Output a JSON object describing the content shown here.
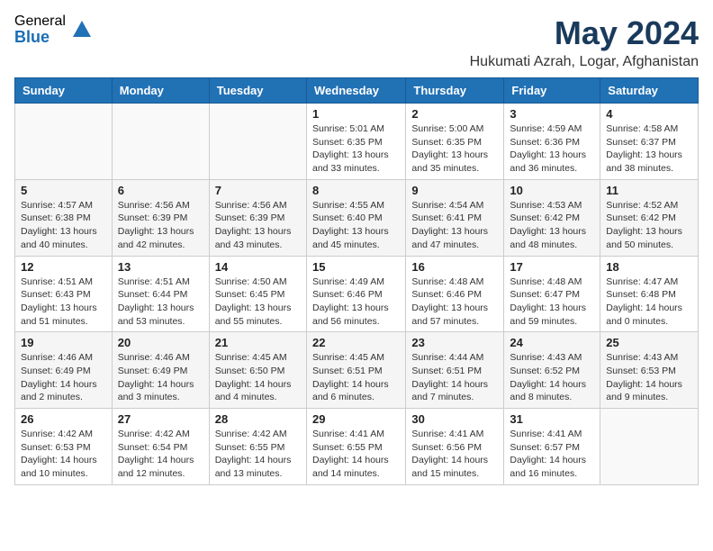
{
  "logo": {
    "general": "General",
    "blue": "Blue"
  },
  "title": {
    "month": "May 2024",
    "location": "Hukumati Azrah, Logar, Afghanistan"
  },
  "weekdays": [
    "Sunday",
    "Monday",
    "Tuesday",
    "Wednesday",
    "Thursday",
    "Friday",
    "Saturday"
  ],
  "weeks": [
    [
      {
        "day": "",
        "sunrise": "",
        "sunset": "",
        "daylight": ""
      },
      {
        "day": "",
        "sunrise": "",
        "sunset": "",
        "daylight": ""
      },
      {
        "day": "",
        "sunrise": "",
        "sunset": "",
        "daylight": ""
      },
      {
        "day": "1",
        "sunrise": "Sunrise: 5:01 AM",
        "sunset": "Sunset: 6:35 PM",
        "daylight": "Daylight: 13 hours and 33 minutes."
      },
      {
        "day": "2",
        "sunrise": "Sunrise: 5:00 AM",
        "sunset": "Sunset: 6:35 PM",
        "daylight": "Daylight: 13 hours and 35 minutes."
      },
      {
        "day": "3",
        "sunrise": "Sunrise: 4:59 AM",
        "sunset": "Sunset: 6:36 PM",
        "daylight": "Daylight: 13 hours and 36 minutes."
      },
      {
        "day": "4",
        "sunrise": "Sunrise: 4:58 AM",
        "sunset": "Sunset: 6:37 PM",
        "daylight": "Daylight: 13 hours and 38 minutes."
      }
    ],
    [
      {
        "day": "5",
        "sunrise": "Sunrise: 4:57 AM",
        "sunset": "Sunset: 6:38 PM",
        "daylight": "Daylight: 13 hours and 40 minutes."
      },
      {
        "day": "6",
        "sunrise": "Sunrise: 4:56 AM",
        "sunset": "Sunset: 6:39 PM",
        "daylight": "Daylight: 13 hours and 42 minutes."
      },
      {
        "day": "7",
        "sunrise": "Sunrise: 4:56 AM",
        "sunset": "Sunset: 6:39 PM",
        "daylight": "Daylight: 13 hours and 43 minutes."
      },
      {
        "day": "8",
        "sunrise": "Sunrise: 4:55 AM",
        "sunset": "Sunset: 6:40 PM",
        "daylight": "Daylight: 13 hours and 45 minutes."
      },
      {
        "day": "9",
        "sunrise": "Sunrise: 4:54 AM",
        "sunset": "Sunset: 6:41 PM",
        "daylight": "Daylight: 13 hours and 47 minutes."
      },
      {
        "day": "10",
        "sunrise": "Sunrise: 4:53 AM",
        "sunset": "Sunset: 6:42 PM",
        "daylight": "Daylight: 13 hours and 48 minutes."
      },
      {
        "day": "11",
        "sunrise": "Sunrise: 4:52 AM",
        "sunset": "Sunset: 6:42 PM",
        "daylight": "Daylight: 13 hours and 50 minutes."
      }
    ],
    [
      {
        "day": "12",
        "sunrise": "Sunrise: 4:51 AM",
        "sunset": "Sunset: 6:43 PM",
        "daylight": "Daylight: 13 hours and 51 minutes."
      },
      {
        "day": "13",
        "sunrise": "Sunrise: 4:51 AM",
        "sunset": "Sunset: 6:44 PM",
        "daylight": "Daylight: 13 hours and 53 minutes."
      },
      {
        "day": "14",
        "sunrise": "Sunrise: 4:50 AM",
        "sunset": "Sunset: 6:45 PM",
        "daylight": "Daylight: 13 hours and 55 minutes."
      },
      {
        "day": "15",
        "sunrise": "Sunrise: 4:49 AM",
        "sunset": "Sunset: 6:46 PM",
        "daylight": "Daylight: 13 hours and 56 minutes."
      },
      {
        "day": "16",
        "sunrise": "Sunrise: 4:48 AM",
        "sunset": "Sunset: 6:46 PM",
        "daylight": "Daylight: 13 hours and 57 minutes."
      },
      {
        "day": "17",
        "sunrise": "Sunrise: 4:48 AM",
        "sunset": "Sunset: 6:47 PM",
        "daylight": "Daylight: 13 hours and 59 minutes."
      },
      {
        "day": "18",
        "sunrise": "Sunrise: 4:47 AM",
        "sunset": "Sunset: 6:48 PM",
        "daylight": "Daylight: 14 hours and 0 minutes."
      }
    ],
    [
      {
        "day": "19",
        "sunrise": "Sunrise: 4:46 AM",
        "sunset": "Sunset: 6:49 PM",
        "daylight": "Daylight: 14 hours and 2 minutes."
      },
      {
        "day": "20",
        "sunrise": "Sunrise: 4:46 AM",
        "sunset": "Sunset: 6:49 PM",
        "daylight": "Daylight: 14 hours and 3 minutes."
      },
      {
        "day": "21",
        "sunrise": "Sunrise: 4:45 AM",
        "sunset": "Sunset: 6:50 PM",
        "daylight": "Daylight: 14 hours and 4 minutes."
      },
      {
        "day": "22",
        "sunrise": "Sunrise: 4:45 AM",
        "sunset": "Sunset: 6:51 PM",
        "daylight": "Daylight: 14 hours and 6 minutes."
      },
      {
        "day": "23",
        "sunrise": "Sunrise: 4:44 AM",
        "sunset": "Sunset: 6:51 PM",
        "daylight": "Daylight: 14 hours and 7 minutes."
      },
      {
        "day": "24",
        "sunrise": "Sunrise: 4:43 AM",
        "sunset": "Sunset: 6:52 PM",
        "daylight": "Daylight: 14 hours and 8 minutes."
      },
      {
        "day": "25",
        "sunrise": "Sunrise: 4:43 AM",
        "sunset": "Sunset: 6:53 PM",
        "daylight": "Daylight: 14 hours and 9 minutes."
      }
    ],
    [
      {
        "day": "26",
        "sunrise": "Sunrise: 4:42 AM",
        "sunset": "Sunset: 6:53 PM",
        "daylight": "Daylight: 14 hours and 10 minutes."
      },
      {
        "day": "27",
        "sunrise": "Sunrise: 4:42 AM",
        "sunset": "Sunset: 6:54 PM",
        "daylight": "Daylight: 14 hours and 12 minutes."
      },
      {
        "day": "28",
        "sunrise": "Sunrise: 4:42 AM",
        "sunset": "Sunset: 6:55 PM",
        "daylight": "Daylight: 14 hours and 13 minutes."
      },
      {
        "day": "29",
        "sunrise": "Sunrise: 4:41 AM",
        "sunset": "Sunset: 6:55 PM",
        "daylight": "Daylight: 14 hours and 14 minutes."
      },
      {
        "day": "30",
        "sunrise": "Sunrise: 4:41 AM",
        "sunset": "Sunset: 6:56 PM",
        "daylight": "Daylight: 14 hours and 15 minutes."
      },
      {
        "day": "31",
        "sunrise": "Sunrise: 4:41 AM",
        "sunset": "Sunset: 6:57 PM",
        "daylight": "Daylight: 14 hours and 16 minutes."
      },
      {
        "day": "",
        "sunrise": "",
        "sunset": "",
        "daylight": ""
      }
    ]
  ]
}
